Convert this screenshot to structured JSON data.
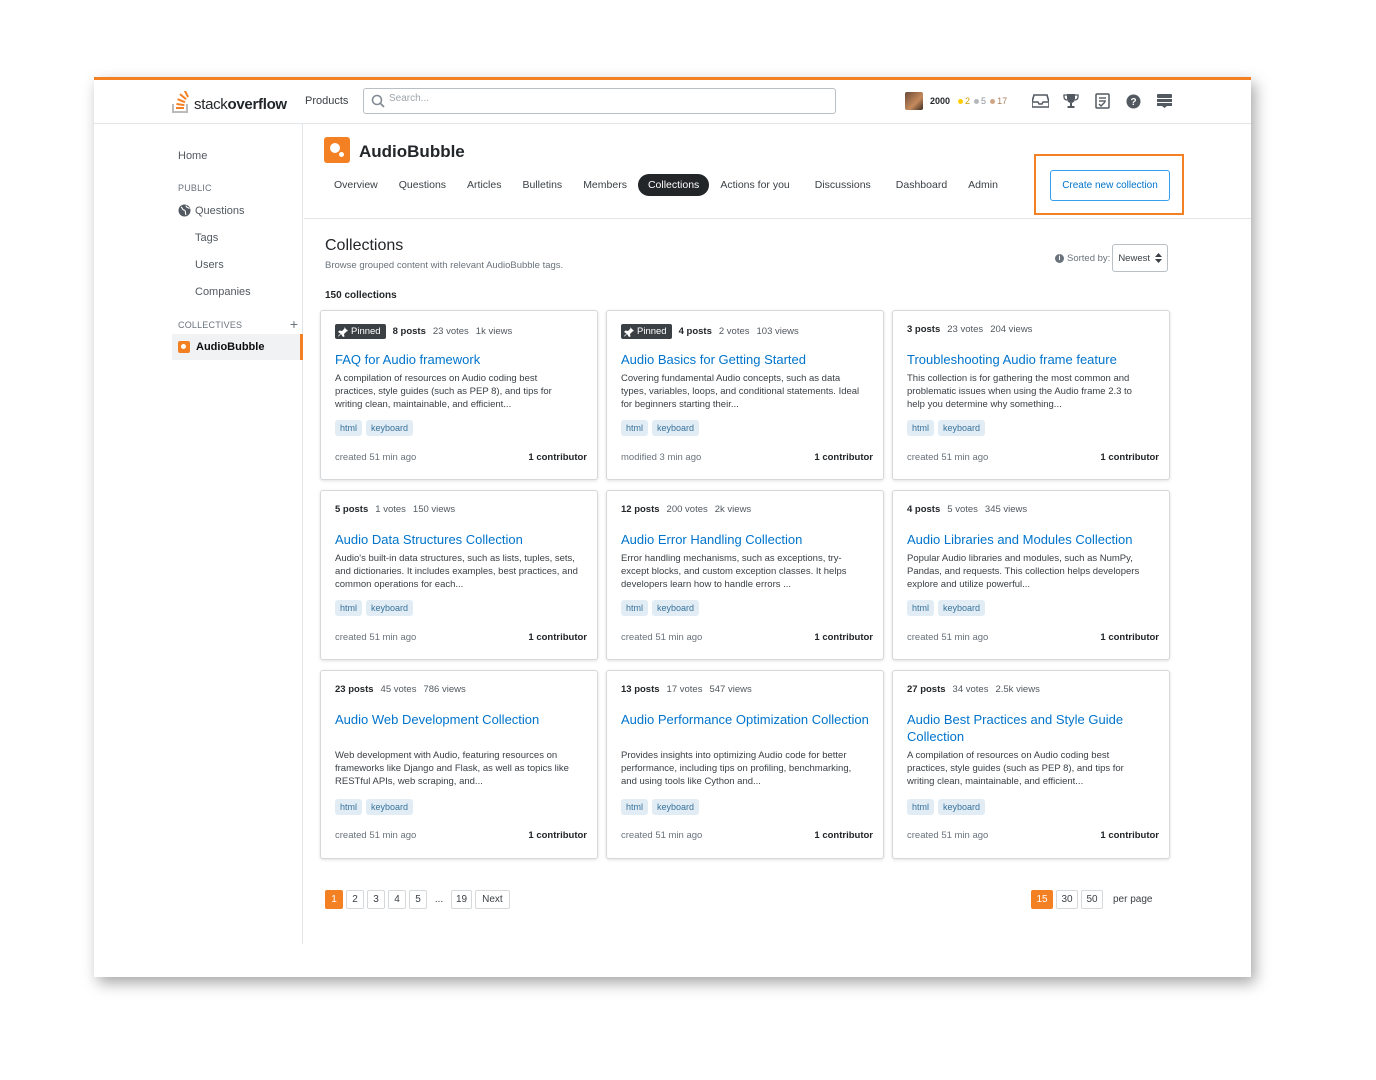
{
  "colors": {
    "accent": "#f48024",
    "link": "#0074cc",
    "dark": "#232629",
    "tag_bg": "#e1ecf4",
    "tag_fg": "#39739d"
  },
  "topbar": {
    "logo_light": "stack",
    "logo_bold": "overflow",
    "products": "Products",
    "search_placeholder": "Search...",
    "reputation": "2000",
    "gold": "2",
    "silver": "5",
    "bronze": "17",
    "icons": [
      "inbox-icon",
      "achievements-icon",
      "review-queue-icon",
      "help-icon",
      "site-switcher-icon"
    ]
  },
  "sidebar": {
    "home": "Home",
    "public_label": "PUBLIC",
    "questions": "Questions",
    "tags": "Tags",
    "users": "Users",
    "companies": "Companies",
    "collectives_label": "COLLECTIVES",
    "add": "+",
    "active_collective": "AudioBubble"
  },
  "collective": {
    "name": "AudioBubble",
    "tabs": [
      "Overview",
      "Questions",
      "Articles",
      "Bulletins",
      "Members",
      "Collections",
      "Actions for you",
      "Discussions",
      "Dashboard",
      "Admin"
    ],
    "active_tab": "Collections",
    "create_button": "Create new collection"
  },
  "main": {
    "heading": "Collections",
    "subheading": "Browse grouped content with relevant AudioBubble tags.",
    "count": "150 collections",
    "sorted_label": "Sorted by:",
    "sorted_value": "Newest"
  },
  "cards": [
    {
      "pinned": "Pinned",
      "posts": "8 posts",
      "votes": "23 votes",
      "views": "1k views",
      "title": "FAQ for Audio framework",
      "desc": "A compilation of resources on Audio coding best practices, style guides (such as PEP 8), and tips for writing clean, maintainable, and efficient...",
      "tags": [
        "html",
        "keyboard"
      ],
      "when": "created 51 min ago",
      "contrib": "1 contributor"
    },
    {
      "pinned": "Pinned",
      "posts": "4 posts",
      "votes": "2 votes",
      "views": "103 views",
      "title": "Audio Basics for Getting Started",
      "desc": "Covering fundamental Audio concepts, such as data types, variables, loops, and conditional statements. Ideal for beginners starting their...",
      "tags": [
        "html",
        "keyboard"
      ],
      "when": "modified 3 min ago",
      "contrib": "1 contributor"
    },
    {
      "pinned": "",
      "posts": "3 posts",
      "votes": "23 votes",
      "views": "204 views",
      "title": "Troubleshooting Audio frame feature",
      "desc": "This collection is for gathering the most common and problematic issues when using the Audio frame 2.3 to help you determine why something...",
      "tags": [
        "html",
        "keyboard"
      ],
      "when": "created 51 min ago",
      "contrib": "1 contributor"
    },
    {
      "pinned": "",
      "posts": "5 posts",
      "votes": "1 votes",
      "views": "150 views",
      "title": "Audio Data Structures Collection",
      "desc": "Audio's built-in data structures, such as lists, tuples, sets, and dictionaries. It includes examples, best practices, and common operations for each...",
      "tags": [
        "html",
        "keyboard"
      ],
      "when": "created 51 min ago",
      "contrib": "1 contributor"
    },
    {
      "pinned": "",
      "posts": "12 posts",
      "votes": "200 votes",
      "views": "2k views",
      "title": "Audio Error Handling Collection",
      "desc": "Error handling mechanisms, such as exceptions, try-except blocks, and custom exception classes. It helps developers learn how to handle errors ...",
      "tags": [
        "html",
        "keyboard"
      ],
      "when": "created 51 min ago",
      "contrib": "1 contributor"
    },
    {
      "pinned": "",
      "posts": "4 posts",
      "votes": "5 votes",
      "views": "345 views",
      "title": "Audio Libraries and Modules Collection",
      "desc": "Popular Audio libraries and modules, such as NumPy, Pandas, and requests. This collection helps developers explore and utilize powerful...",
      "tags": [
        "html",
        "keyboard"
      ],
      "when": "created 51 min ago",
      "contrib": "1 contributor"
    },
    {
      "pinned": "",
      "posts": "23 posts",
      "votes": "45 votes",
      "views": "786 views",
      "title": "Audio Web Development Collection",
      "desc": "Web development with Audio, featuring resources on frameworks like Django and Flask, as well as topics like RESTful APIs, web scraping, and...",
      "tags": [
        "html",
        "keyboard"
      ],
      "when": "created 51 min ago",
      "contrib": "1 contributor"
    },
    {
      "pinned": "",
      "posts": "13 posts",
      "votes": "17 votes",
      "views": "547 views",
      "title": "Audio Performance Optimization Collection",
      "desc": "Provides insights into optimizing Audio code for better performance, including tips on profiling, benchmarking, and using tools like Cython and...",
      "tags": [
        "html",
        "keyboard"
      ],
      "when": "created 51 min ago",
      "contrib": "1 contributor"
    },
    {
      "pinned": "",
      "posts": "27 posts",
      "votes": "34 votes",
      "views": "2.5k views",
      "title": "Audio Best Practices and Style Guide Collection",
      "desc": "A compilation of resources on Audio coding best practices, style guides (such as PEP 8), and tips for writing clean, maintainable, and efficient...",
      "tags": [
        "html",
        "keyboard"
      ],
      "when": "created 51 min ago",
      "contrib": "1 contributor"
    }
  ],
  "pagination": {
    "pages": [
      "1",
      "2",
      "3",
      "4",
      "5",
      "...",
      "19",
      "Next"
    ],
    "current": "1",
    "per_page": [
      "15",
      "30",
      "50"
    ],
    "per_page_current": "15",
    "per_page_label": "per page"
  }
}
